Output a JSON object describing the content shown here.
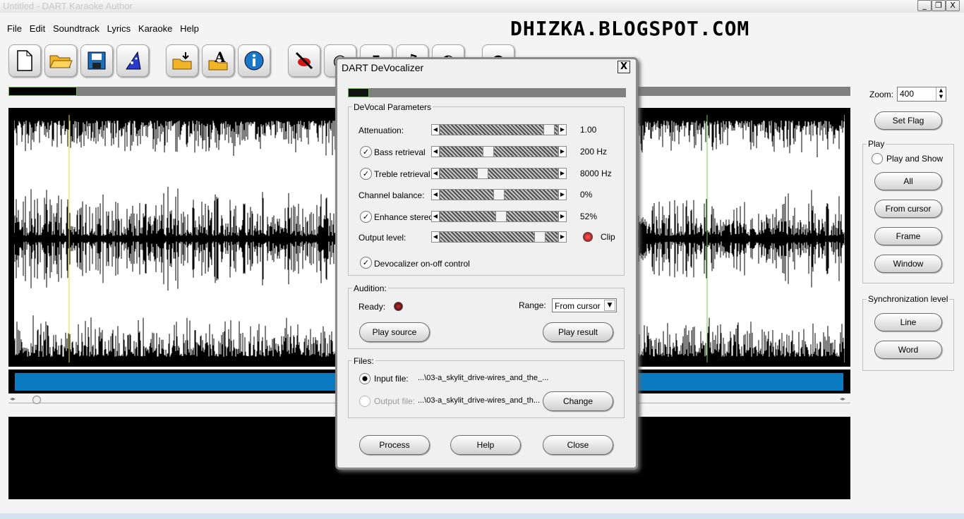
{
  "window": {
    "title": "Untitled - DART Karaoke Author",
    "minimize": "_",
    "maximize": "❐",
    "close": "X"
  },
  "menu": [
    "File",
    "Edit",
    "Soundtrack",
    "Lyrics",
    "Karaoke",
    "Help"
  ],
  "watermark": "DHIZKA.BLOGSPOT.COM",
  "toolbar": [
    "new-document-icon",
    "open-folder-icon",
    "save-disk-icon",
    "wizard-hat-icon",
    "import-icon",
    "text-icon",
    "info-icon",
    "devocalizer-icon",
    "tool-icon",
    "tool-icon",
    "tool-icon",
    "tool-icon",
    "tool-icon"
  ],
  "right": {
    "zoom_label": "Zoom:",
    "zoom_value": "400",
    "set_flag": "Set Flag",
    "play_group": "Play",
    "play_and_show": "Play and Show",
    "all": "All",
    "from_cursor": "From cursor",
    "frame": "Frame",
    "window": "Window",
    "sync_group": "Synchronization level",
    "line": "Line",
    "word": "Word"
  },
  "dialog": {
    "title": "DART DeVocalizer",
    "close": "X",
    "params_group": "DeVocal Parameters",
    "params": [
      {
        "label": "Attenuation:",
        "value": "1.00",
        "checkbox": false,
        "level": 0.97
      },
      {
        "label": "Bass retrieval",
        "value": "200 Hz",
        "checkbox": true,
        "level": 0.4
      },
      {
        "label": "Treble retrieval",
        "value": "8000 Hz",
        "checkbox": true,
        "level": 0.35
      },
      {
        "label": "Channel balance:",
        "value": "0%",
        "checkbox": false,
        "level": 0.5
      },
      {
        "label": "Enhance stereo",
        "value": "52%",
        "checkbox": true,
        "level": 0.52
      },
      {
        "label": "Output level:",
        "value": "Clip",
        "checkbox": false,
        "level": 0.88
      }
    ],
    "devocalizer_control": "Devocalizer on-off control",
    "audition_group": "Audition:",
    "ready": "Ready:",
    "range_label": "Range:",
    "range_value": "From cursor",
    "play_source": "Play source",
    "play_result": "Play result",
    "files_group": "Files:",
    "input_label": "Input file:",
    "input_value": "...\\03-a_skylit_drive-wires_and_the_...",
    "output_label": "Output file:",
    "output_value": "...\\03-a_skylit_drive-wires_and_th...",
    "change": "Change",
    "process": "Process",
    "help": "Help",
    "close_btn": "Close"
  }
}
